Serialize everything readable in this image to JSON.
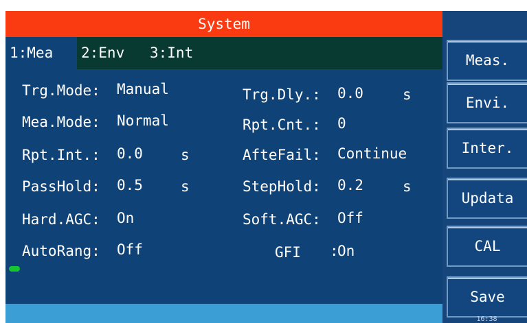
{
  "title": "System",
  "tabs": [
    {
      "label": "1:Mea"
    },
    {
      "label": "2:Env"
    },
    {
      "label": "3:Int"
    }
  ],
  "fields": {
    "trg_mode": {
      "label": "Trg.Mode:",
      "value": "Manual"
    },
    "mea_mode": {
      "label": "Mea.Mode:",
      "value": "Normal"
    },
    "rpt_int": {
      "label": "Rpt.Int.:",
      "value": "0.0",
      "unit": "s"
    },
    "pass_hold": {
      "label": "PassHold:",
      "value": "0.5",
      "unit": "s"
    },
    "hard_agc": {
      "label": "Hard.AGC:",
      "value": "On"
    },
    "auto_rang": {
      "label": "AutoRang:",
      "value": "Off"
    },
    "trg_dly": {
      "label": "Trg.Dly.:",
      "value": "0.0",
      "unit": "s"
    },
    "rpt_cnt": {
      "label": "Rpt.Cnt.:",
      "value": "0"
    },
    "afte_fail": {
      "label": "AfteFail:",
      "value": "Continue"
    },
    "step_hold": {
      "label": "StepHold:",
      "value": "0.2",
      "unit": "s"
    },
    "soft_agc": {
      "label": "Soft.AGC:",
      "value": "Off"
    },
    "gfi": {
      "label": "GFI",
      "sep": ":",
      "value": "On"
    }
  },
  "side_buttons": [
    {
      "label": "Meas."
    },
    {
      "label": "Envi."
    },
    {
      "label": "Inter."
    },
    {
      "label": "Updata"
    },
    {
      "label": "CAL"
    },
    {
      "label": "Save"
    }
  ],
  "clock": "16:38",
  "colors": {
    "title_bg": "#fa3a10",
    "tab_bar_bg": "#093a32",
    "main_bg": "#0f4377",
    "status_bar_bg": "#3b9fd6",
    "side_panel_bg": "#15457a",
    "cursor": "#17c531"
  }
}
